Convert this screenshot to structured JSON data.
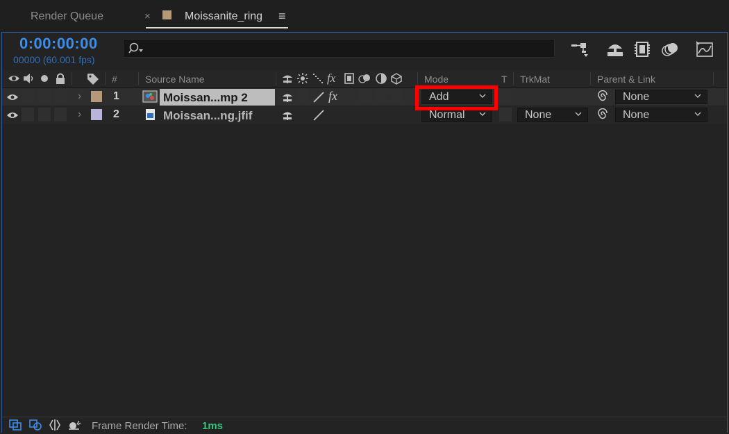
{
  "tabs": {
    "render_queue": "Render Queue",
    "close_glyph": "×",
    "composition": "Moissanite_ring",
    "menu_glyph": "≡"
  },
  "timecode": "0:00:00:00",
  "fps_readout": "00000 (60.001 fps)",
  "search": {
    "value": "",
    "placeholder": ""
  },
  "toolbar_icons": [
    "comp-flowchart-icon",
    "draft-3d-icon",
    "frame-blending-icon",
    "motion-blur-icon",
    "graph-editor-icon"
  ],
  "columns": {
    "number": "#",
    "source_name": "Source Name",
    "fx": "fx",
    "mode": "Mode",
    "t": "T",
    "trkmat": "TrkMat",
    "parent": "Parent & Link"
  },
  "layers": [
    {
      "number": "1",
      "name": "Moissan...mp 2",
      "label_color": "#b49a78",
      "fx": "fx",
      "mode": "Add",
      "trkmat": "",
      "parent": "None"
    },
    {
      "number": "2",
      "name": "Moissan...ng.jfif",
      "label_color": "#b8b4dc",
      "fx": "",
      "mode": "Normal",
      "trkmat": "None",
      "parent": "None"
    }
  ],
  "status": {
    "label": "Frame Render Time:",
    "value": "1ms"
  },
  "colors": {
    "accent_blue": "#3c8eec",
    "highlight_red": "#ff0000",
    "render_time_green": "#39c47c"
  }
}
